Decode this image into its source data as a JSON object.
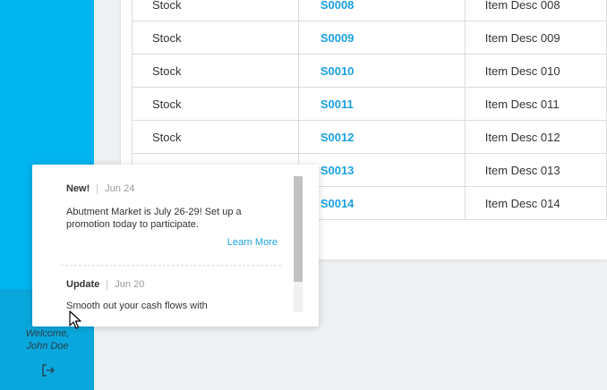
{
  "sidebar": {
    "welcome_line1": "Welcome,",
    "welcome_line2": "John Doe",
    "notification_badge_color": "#f7941d",
    "bell_icon": "bell-icon",
    "logout_icon": "logout-icon"
  },
  "table": {
    "rows": [
      {
        "type": "Stock",
        "code": "S0008",
        "desc": "Item Desc 008"
      },
      {
        "type": "Stock",
        "code": "S0009",
        "desc": "Item Desc 009"
      },
      {
        "type": "Stock",
        "code": "S0010",
        "desc": "Item Desc 010"
      },
      {
        "type": "Stock",
        "code": "S0011",
        "desc": "Item Desc 011"
      },
      {
        "type": "Stock",
        "code": "S0012",
        "desc": "Item Desc 012"
      },
      {
        "type": "",
        "code": "S0013",
        "desc": "Item Desc 013"
      },
      {
        "type": "",
        "code": "S0014",
        "desc": "Item Desc 014"
      }
    ]
  },
  "notifications": [
    {
      "title": "New!",
      "date": "Jun 24",
      "body": "Abutment Market is July 26-29! Set up a promotion today to participate.",
      "link": "Learn More"
    },
    {
      "title": "Update",
      "date": "Jun 20",
      "body": "Smooth out your cash flows with"
    }
  ],
  "colors": {
    "sidebar": "#00b4f0",
    "link": "#1ba1e2"
  }
}
